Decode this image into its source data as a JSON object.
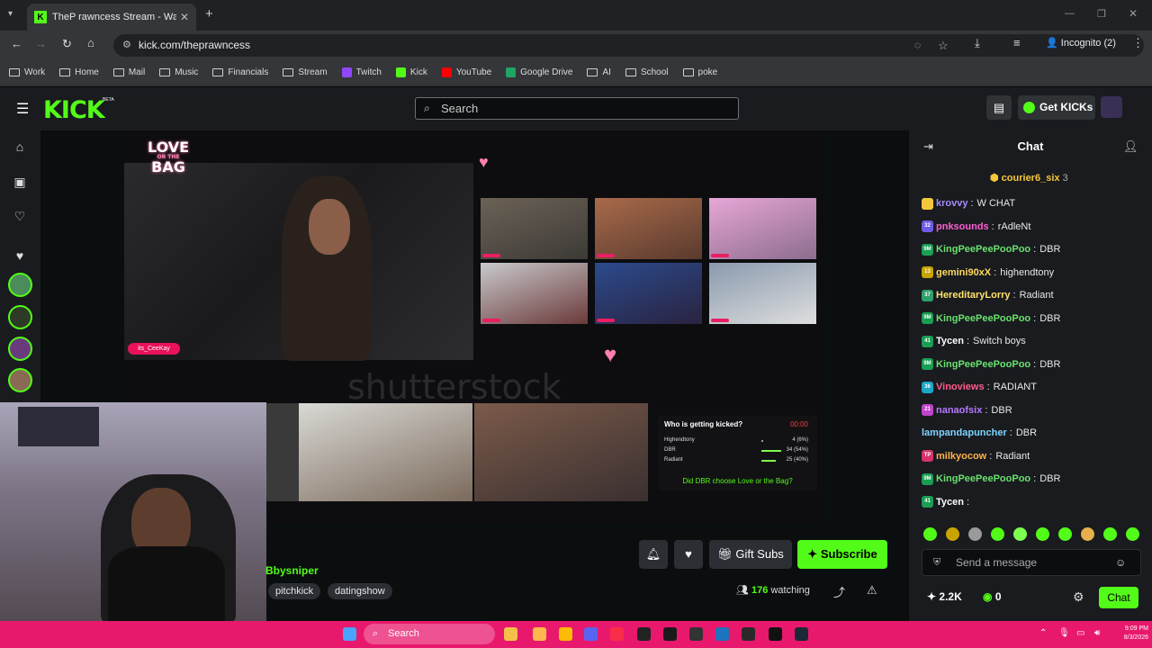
{
  "browser": {
    "tab_title": "TheP rawncess Stream - Wa",
    "url": "kick.com/theprawncess",
    "incognito_label": "Incognito (2)"
  },
  "bookmarks": [
    {
      "label": "Work",
      "icon": "folder-icon"
    },
    {
      "label": "Home",
      "icon": "folder-icon"
    },
    {
      "label": "Mail",
      "icon": "folder-icon"
    },
    {
      "label": "Music",
      "icon": "folder-icon"
    },
    {
      "label": "Financials",
      "icon": "folder-icon"
    },
    {
      "label": "Stream",
      "icon": "folder-icon"
    },
    {
      "label": "Twitch",
      "icon": "twitch-icon"
    },
    {
      "label": "Kick",
      "icon": "kick-icon"
    },
    {
      "label": "YouTube",
      "icon": "youtube-icon"
    },
    {
      "label": "Google Drive",
      "icon": "google-drive-icon"
    },
    {
      "label": "AI",
      "icon": "folder-icon"
    },
    {
      "label": "School",
      "icon": "folder-icon"
    },
    {
      "label": "poke",
      "icon": "folder-icon"
    }
  ],
  "kick": {
    "logo": "KICK",
    "beta": "BETA",
    "search_placeholder": "Search",
    "get_kicks": "Get KICKs"
  },
  "stream": {
    "logo_line1": "LOVE",
    "logo_line2": "OR THE",
    "logo_line3": "BAG",
    "main_name_tag": "its_CeeKay",
    "watermark": "shutterstock",
    "poll": {
      "question": "Who is getting kicked?",
      "timer": "00:00",
      "options": [
        {
          "name": "Highendtony",
          "value": "4 (6%)",
          "percent": 6
        },
        {
          "name": "DBR",
          "value": "34 (54%)",
          "percent": 54
        },
        {
          "name": "Radiant",
          "value": "25 (40%)",
          "percent": 40
        }
      ],
      "footer": "Did DBR choose Love or the Bag?"
    }
  },
  "below_player": {
    "username": "Bbysniper",
    "tags": [
      "pitchkick",
      "datingshow"
    ],
    "gift_subs": "Gift Subs",
    "subscribe": "Subscribe",
    "viewer_count": "176",
    "watching_label": "watching"
  },
  "chat": {
    "title": "Chat",
    "pinned_user": "courier6_six",
    "pinned_count": "3",
    "messages": [
      {
        "user": "krovvy",
        "text": "W CHAT",
        "color": "#a78bfa",
        "badge": "",
        "badge_color": "#f5c83b"
      },
      {
        "user": "pnksounds",
        "text": "rAdleNt",
        "color": "#ff5fd1",
        "badge": "32",
        "badge_color": "#6c5ce7"
      },
      {
        "user": "KingPeePeePooPoo",
        "text": "DBR",
        "color": "#69e26e",
        "badge": "9M",
        "badge_color": "#1a9e54"
      },
      {
        "user": "gemini90xX",
        "text": "highendtony",
        "color": "#ffd95c",
        "badge": "13",
        "badge_color": "#c9a400"
      },
      {
        "user": "HereditaryLorry",
        "text": "Radiant",
        "color": "#ffe26a",
        "badge": "37",
        "badge_color": "#2ea06a"
      },
      {
        "user": "KingPeePeePooPoo",
        "text": "DBR",
        "color": "#69e26e",
        "badge": "9M",
        "badge_color": "#1a9e54"
      },
      {
        "user": "Tycen",
        "text": "Switch boys",
        "color": "#ffffff",
        "badge": "41",
        "badge_color": "#1a9e54"
      },
      {
        "user": "KingPeePeePooPoo",
        "text": "DBR",
        "color": "#69e26e",
        "badge": "9M",
        "badge_color": "#1a9e54"
      },
      {
        "user": "Vinoviews",
        "text": "RADIANT",
        "color": "#ff5a8a",
        "badge": "36",
        "badge_color": "#1aa6c4"
      },
      {
        "user": "nanaofsix",
        "text": "DBR",
        "color": "#b779ff",
        "badge": "21",
        "badge_color": "#c044c9"
      },
      {
        "user": "lampandapuncher",
        "text": "DBR",
        "color": "#7fd3ff",
        "badge": "",
        "badge_color": ""
      },
      {
        "user": "milkyocow",
        "text": "Radiant",
        "color": "#ffb14a",
        "badge": "TP",
        "badge_color": "#d6336c"
      },
      {
        "user": "KingPeePeePooPoo",
        "text": "DBR",
        "color": "#69e26e",
        "badge": "9M",
        "badge_color": "#1a9e54"
      },
      {
        "user": "Tycen",
        "text": "",
        "color": "#ffffff",
        "badge": "41",
        "badge_color": "#1a9e54"
      }
    ],
    "send_placeholder": "Send a message",
    "kicks_count": "2.2K",
    "points_count": "0",
    "chat_button": "Chat"
  },
  "taskbar": {
    "search_label": "Search",
    "time": "9:09 PM",
    "date": "8/3/2026"
  },
  "colors": {
    "kick_green": "#53fc18",
    "taskbar_pink": "#e8196c",
    "background": "#0b0e0f"
  }
}
